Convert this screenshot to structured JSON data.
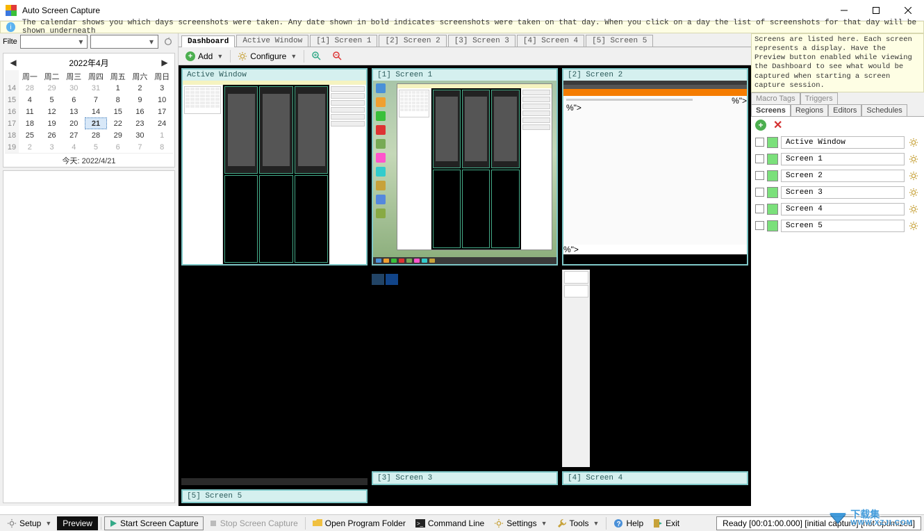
{
  "title": "Auto Screen Capture",
  "infobar": "The calendar shows you which days screenshots were taken. Any date shown in bold indicates screenshots were taken on that day. When you click on a day the list of screenshots for that day will be shown underneath",
  "filter_label": "Filte",
  "calendar": {
    "title": "2022年4月",
    "day_headers": [
      "周一",
      "周二",
      "周三",
      "周四",
      "周五",
      "周六",
      "周日"
    ],
    "weeks": [
      {
        "wn": "14",
        "days": [
          {
            "n": "28",
            "o": true
          },
          {
            "n": "29",
            "o": true
          },
          {
            "n": "30",
            "o": true
          },
          {
            "n": "31",
            "o": true
          },
          {
            "n": "1"
          },
          {
            "n": "2"
          },
          {
            "n": "3"
          }
        ]
      },
      {
        "wn": "15",
        "days": [
          {
            "n": "4"
          },
          {
            "n": "5"
          },
          {
            "n": "6"
          },
          {
            "n": "7"
          },
          {
            "n": "8"
          },
          {
            "n": "9"
          },
          {
            "n": "10"
          }
        ]
      },
      {
        "wn": "16",
        "days": [
          {
            "n": "11"
          },
          {
            "n": "12"
          },
          {
            "n": "13"
          },
          {
            "n": "14"
          },
          {
            "n": "15"
          },
          {
            "n": "16"
          },
          {
            "n": "17"
          }
        ]
      },
      {
        "wn": "17",
        "days": [
          {
            "n": "18"
          },
          {
            "n": "19"
          },
          {
            "n": "20"
          },
          {
            "n": "21",
            "sel": true,
            "b": true
          },
          {
            "n": "22"
          },
          {
            "n": "23"
          },
          {
            "n": "24"
          }
        ]
      },
      {
        "wn": "18",
        "days": [
          {
            "n": "25"
          },
          {
            "n": "26"
          },
          {
            "n": "27"
          },
          {
            "n": "28"
          },
          {
            "n": "29"
          },
          {
            "n": "30"
          },
          {
            "n": "1",
            "o": true
          }
        ]
      },
      {
        "wn": "19",
        "days": [
          {
            "n": "2",
            "o": true
          },
          {
            "n": "3",
            "o": true
          },
          {
            "n": "4",
            "o": true
          },
          {
            "n": "5",
            "o": true
          },
          {
            "n": "6",
            "o": true
          },
          {
            "n": "7",
            "o": true
          },
          {
            "n": "8",
            "o": true
          }
        ]
      }
    ],
    "today_label": "今天: 2022/4/21"
  },
  "center_tabs": [
    "Dashboard",
    "Active Window",
    "[1] Screen 1",
    "[2] Screen 2",
    "[3] Screen 3",
    "[4] Screen 4",
    "[5] Screen 5"
  ],
  "toolbar": {
    "add": "Add",
    "configure": "Configure"
  },
  "tiles": [
    {
      "label": "Active Window",
      "kind": "app"
    },
    {
      "label": "[1] Screen 1",
      "kind": "desktop"
    },
    {
      "label": "[2] Screen 2",
      "kind": "browser"
    },
    {
      "label": "[3] Screen 3",
      "kind": "blank"
    },
    {
      "label": "[4] Screen 4",
      "kind": "blank"
    },
    {
      "label": "[5] Screen 5",
      "kind": "blank"
    }
  ],
  "right_info": "Screens are listed here. Each screen represents a display. Have the Preview button enabled while viewing the Dashboard to see what would be captured when starting a screen capture session.",
  "right_tabs_top": [
    "Macro Tags",
    "Triggers"
  ],
  "right_tabs_bot": [
    "Screens",
    "Regions",
    "Editors",
    "Schedules"
  ],
  "screens": [
    "Active Window",
    "Screen 1",
    "Screen 2",
    "Screen 3",
    "Screen 4",
    "Screen 5"
  ],
  "statusbar": {
    "setup": "Setup",
    "preview": "Preview",
    "start": "Start Screen Capture",
    "stop": "Stop Screen Capture",
    "open_folder": "Open Program Folder",
    "cmdline": "Command Line",
    "settings": "Settings",
    "tools": "Tools",
    "help": "Help",
    "exit": "Exit",
    "status": "Ready [00:01:00.000] [initial capture] [not optimized]"
  },
  "watermark": {
    "line1": "下载集",
    "line2": "WWW.XZJI.COM"
  }
}
